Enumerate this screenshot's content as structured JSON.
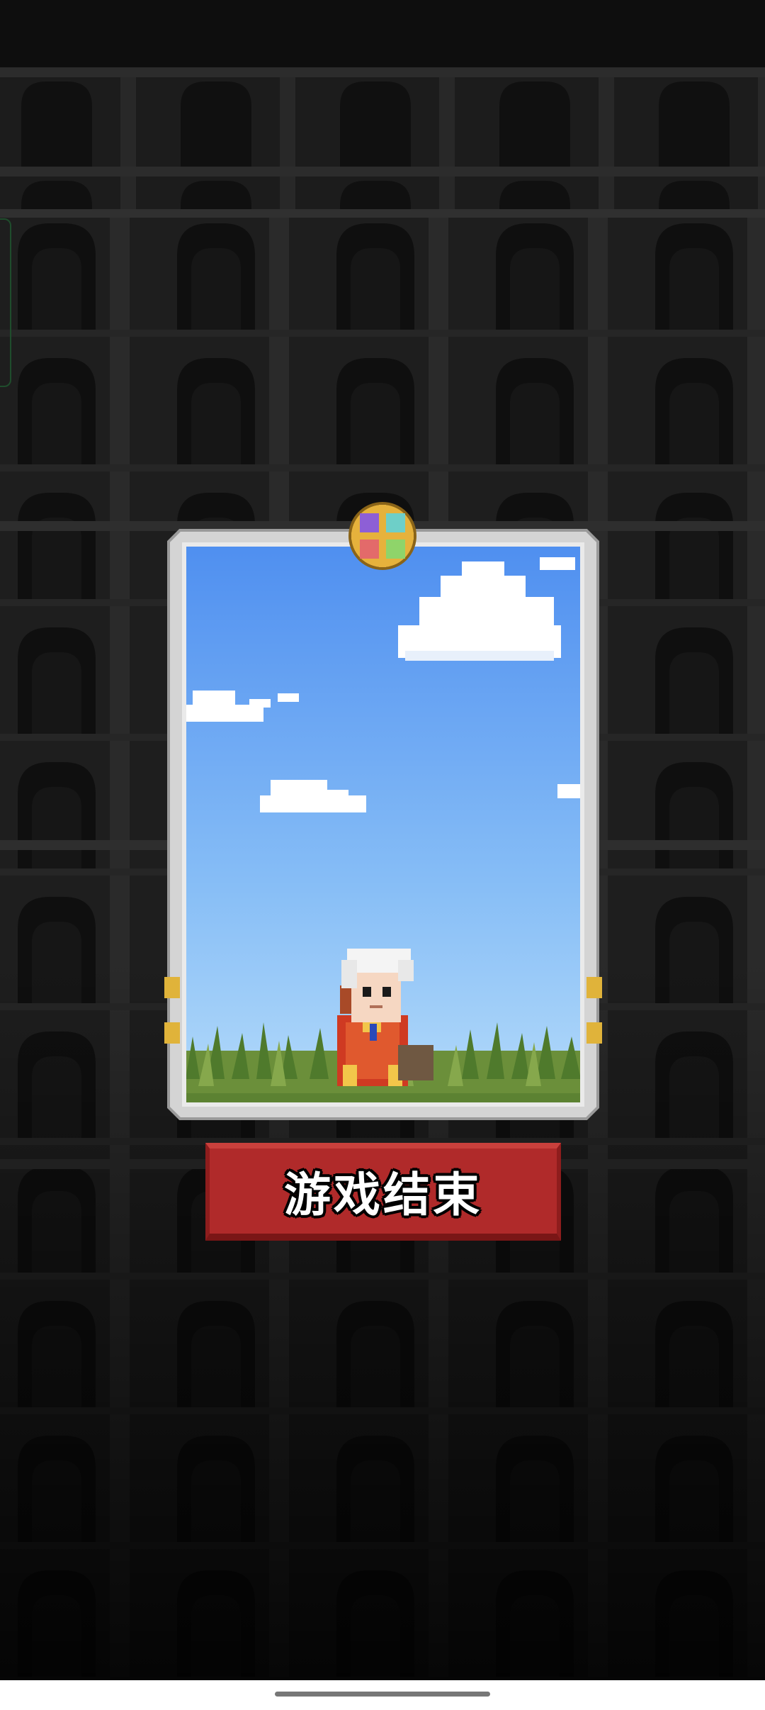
{
  "game": {
    "end_button_label": "游戏结束"
  },
  "icons": {
    "card_emblem": "compass-gem-icon",
    "hero": "white-haired-hero-sprite"
  },
  "colors": {
    "sky_top": "#4f8ff0",
    "sky_bottom": "#a9d4f9",
    "card_frame": "#c8c8c8",
    "button_red": "#b02a2a",
    "background": "#121212"
  }
}
